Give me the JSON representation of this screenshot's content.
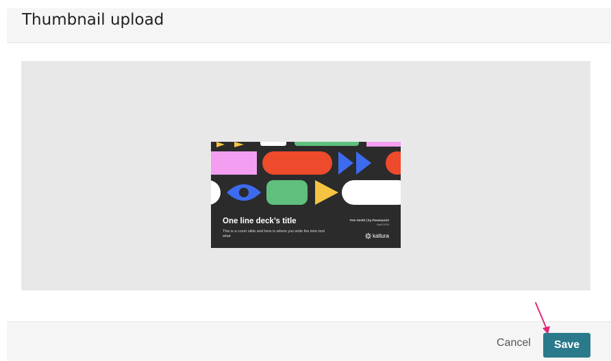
{
  "dialog": {
    "title": "Thumbnail upload"
  },
  "thumbnail": {
    "slide_title": "One line deck’s title",
    "slide_subtitle": "This is a cover slide and here is where you write the intro text what",
    "author": "Tom Smith | by Powerpoint",
    "date": "April 2024",
    "brand": "kaltura"
  },
  "footer": {
    "cancel_label": "Cancel",
    "save_label": "Save"
  },
  "colors": {
    "save_button": "#2a7a8c",
    "annotation_arrow": "#e0267a"
  }
}
